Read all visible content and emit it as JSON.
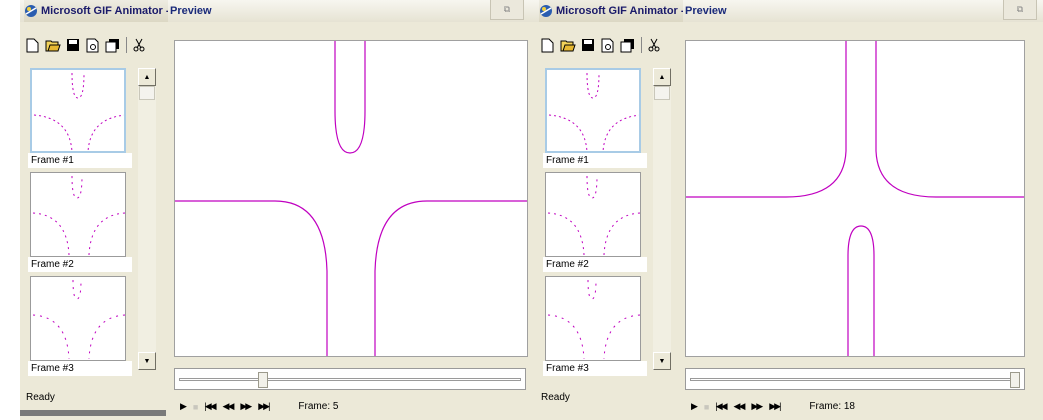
{
  "colors": {
    "curve": "#c000c0",
    "selection": "#a8cbe6",
    "window_bg": "#ece9d8"
  },
  "windows": [
    {
      "app_title": "Microsoft GIF Animator -",
      "preview_title": "Preview",
      "restore_icon": "restore-icon",
      "toolbar": [
        "new-icon",
        "open-icon",
        "save-icon",
        "print-preview-icon",
        "insert-icon",
        "cut-icon"
      ],
      "frames": [
        {
          "label": "Frame #1",
          "selected": true
        },
        {
          "label": "Frame #2",
          "selected": false
        },
        {
          "label": "Frame #3",
          "selected": false
        }
      ],
      "status": "Ready",
      "frame_readout": "Frame:  5",
      "slider_fraction": 0.25
    },
    {
      "app_title": "Microsoft GIF Animator -",
      "preview_title": "Preview",
      "restore_icon": "restore-icon",
      "toolbar": [
        "new-icon",
        "open-icon",
        "save-icon",
        "print-preview-icon",
        "insert-icon",
        "cut-icon"
      ],
      "frames": [
        {
          "label": "Frame #1",
          "selected": true
        },
        {
          "label": "Frame #2",
          "selected": false
        },
        {
          "label": "Frame #3",
          "selected": false
        }
      ],
      "status": "Ready",
      "frame_readout": "Frame:  18",
      "slider_fraction": 0.95
    }
  ]
}
